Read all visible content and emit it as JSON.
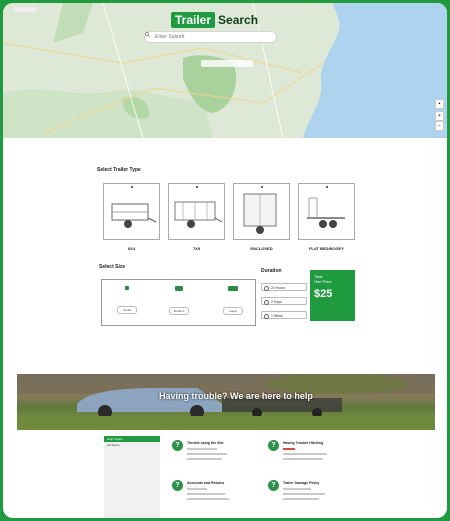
{
  "header": {
    "brand_part1": "Trailer",
    "brand_part2": "Search",
    "search_placeholder": "Enter Suburb"
  },
  "trailer_type": {
    "title": "Select Trailer Type",
    "items": [
      {
        "label": "6X4"
      },
      {
        "label": "7X5"
      },
      {
        "label": "ENCLOSED"
      },
      {
        "label": "FLAT BED/BOGEY"
      }
    ]
  },
  "size": {
    "title": "Select Size",
    "options": [
      {
        "label": "Small"
      },
      {
        "label": "Medium"
      },
      {
        "label": "Large"
      }
    ]
  },
  "duration": {
    "title": "Duration",
    "options": [
      {
        "label": "24 Hours"
      },
      {
        "label": "2 Days"
      },
      {
        "label": "1 Week"
      }
    ]
  },
  "price": {
    "line1": "Total",
    "line2": "Hire Price",
    "amount": "$25"
  },
  "banner": {
    "text": "Having trouble? We are here to help"
  },
  "help": {
    "sidebar": {
      "active": "Help Topics",
      "item": "All Topics"
    },
    "items": [
      {
        "title": "Trouble using the Site",
        "icon": "?"
      },
      {
        "title": "Having Trouble Hitching",
        "icon": "?"
      },
      {
        "title": "Accounts and Returns",
        "icon": "?"
      },
      {
        "title": "Trailer Damage Policy",
        "icon": "?"
      }
    ]
  },
  "colors": {
    "accent": "#1f9a3f",
    "frame": "#1f9a3f"
  }
}
